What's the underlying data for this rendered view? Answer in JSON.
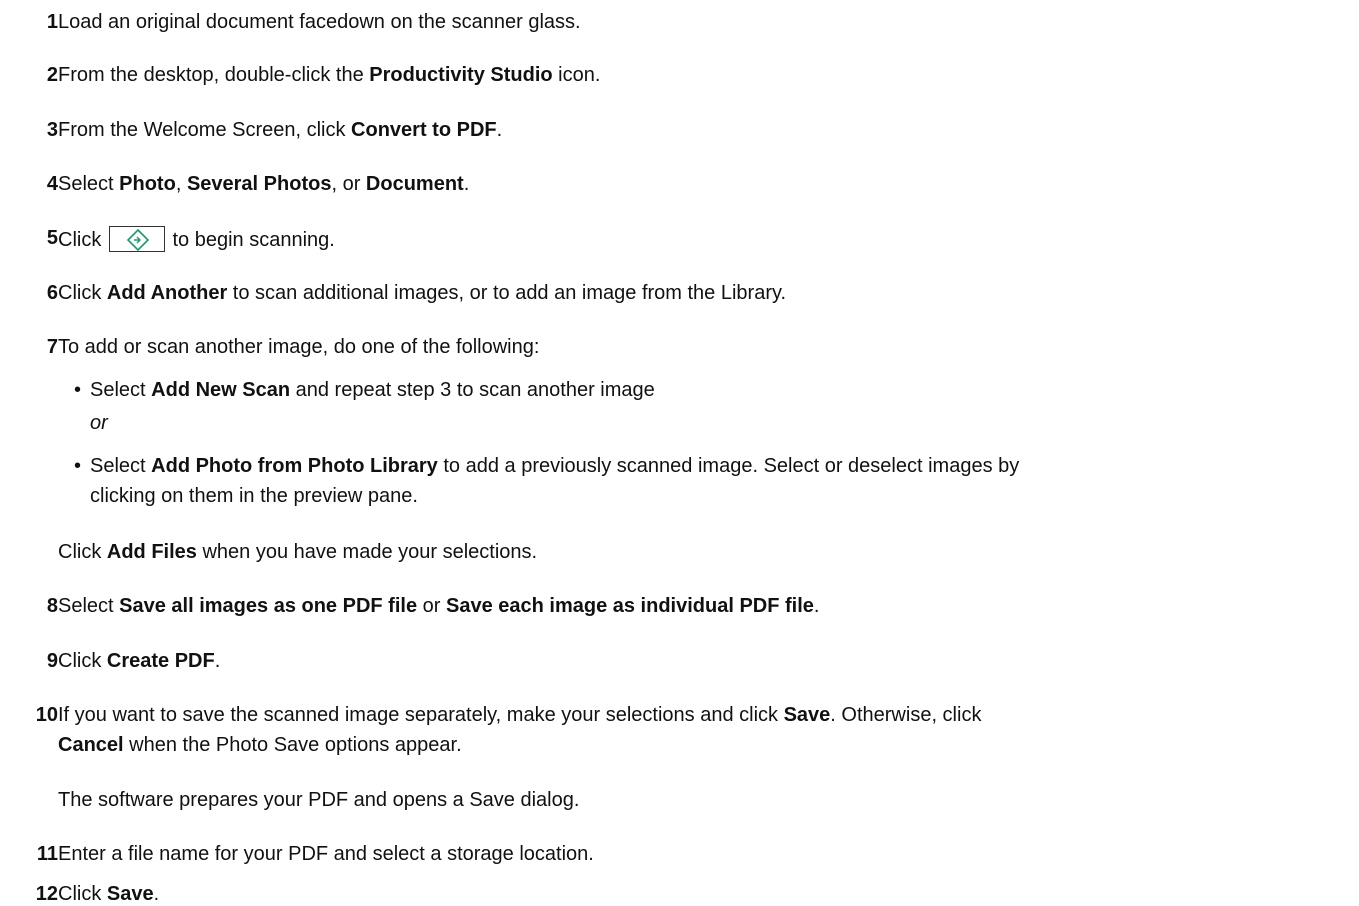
{
  "steps": [
    {
      "num": "1",
      "parts": [
        "Load an original document facedown on the scanner glass."
      ]
    },
    {
      "num": "2",
      "parts": [
        "From the desktop, double-click the ",
        "Productivity Studio",
        " icon."
      ]
    },
    {
      "num": "3",
      "parts": [
        "From the Welcome Screen, click ",
        "Convert to PDF",
        "."
      ]
    },
    {
      "num": "4",
      "parts": [
        "Select ",
        "Photo",
        ", ",
        "Several Photos",
        ", or ",
        "Document",
        "."
      ]
    },
    {
      "num": "5",
      "before": "Click",
      "after": "to begin scanning.",
      "icon": "start-scan-diamond-icon"
    },
    {
      "num": "6",
      "parts": [
        "Click ",
        "Add Another",
        " to scan additional images, or to add an image from the Library."
      ]
    },
    {
      "num": "7",
      "parts": [
        "To add or scan another image, do one of the following:"
      ]
    },
    {
      "num": "8",
      "parts": [
        "Select ",
        "Save all images as one PDF file",
        " or ",
        "Save each image as individual PDF file",
        "."
      ]
    },
    {
      "num": "9",
      "parts": [
        "Click ",
        "Create PDF",
        "."
      ]
    },
    {
      "num": "10",
      "parts": [
        "If you want to save the scanned image separately, make your selections and click ",
        "Save",
        ". Otherwise, click "
      ],
      "line2": [
        "Cancel",
        " when the Photo Save options appear."
      ]
    },
    {
      "num": "11",
      "parts": [
        "Enter a file name for your PDF and select a storage location."
      ]
    },
    {
      "num": "12",
      "parts": [
        "Click ",
        "Save",
        "."
      ]
    }
  ],
  "step7_bullets": [
    {
      "parts": [
        "Select ",
        "Add New Scan",
        " and repeat step 3 to scan another image"
      ]
    },
    {
      "parts": [
        "Select ",
        "Add Photo from Photo Library",
        " to add a previously scanned image. Select or deselect images by"
      ],
      "line2": "clicking on them in the preview pane."
    }
  ],
  "step7_or": "or",
  "step7_after": [
    "Click ",
    "Add Files",
    " when you have made your selections."
  ],
  "step10_after": "The software prepares your PDF and opens a Save dialog.",
  "bullet_char": "•",
  "colors": {
    "text": "#111111",
    "icon": "#1a9a6a",
    "background": "#ffffff"
  }
}
